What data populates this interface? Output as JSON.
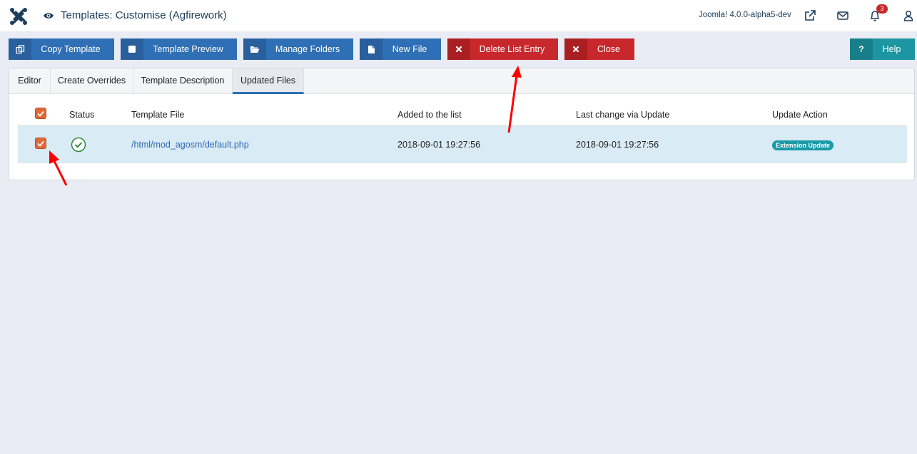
{
  "header": {
    "title": "Templates: Customise (Agfirework)",
    "version": "Joomla! 4.0.0-alpha5-dev",
    "notification_count": "3",
    "icons": [
      "joomla-logo-icon",
      "eye-icon",
      "external-link-icon",
      "envelope-icon",
      "bell-icon",
      "user-icon"
    ]
  },
  "toolbar": {
    "copy_template": "Copy Template",
    "template_preview": "Template Preview",
    "manage_folders": "Manage Folders",
    "new_file": "New File",
    "delete_list_entry": "Delete List Entry",
    "close": "Close",
    "help": "Help",
    "help_icon": "?"
  },
  "tabs": [
    "Editor",
    "Create Overrides",
    "Template Description",
    "Updated Files"
  ],
  "active_tab": "Updated Files",
  "table": {
    "headers": {
      "status": "Status",
      "template_file": "Template File",
      "added": "Added to the list",
      "last_change": "Last change via Update",
      "update_action": "Update Action"
    },
    "rows": [
      {
        "checked": true,
        "status": "ok",
        "template_file": "/html/mod_agosm/default.php",
        "added": "2018-09-01 19:27:56",
        "last_change": "2018-09-01 19:27:56",
        "update_action": "Extension Update"
      }
    ]
  },
  "colors": {
    "primary": "#2f6fb5",
    "danger": "#c8282c",
    "info": "#1d96a2",
    "checkbox": "#e2683a",
    "annotation_arrow": "#ff0000"
  }
}
